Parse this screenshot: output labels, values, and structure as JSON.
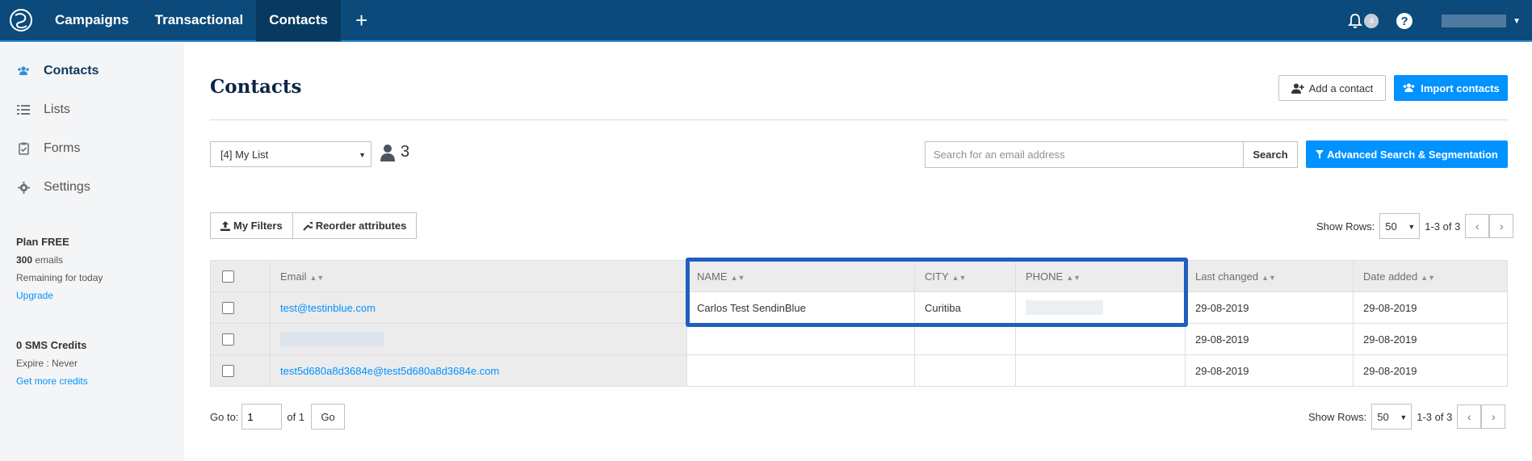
{
  "topnav": {
    "items": [
      "Campaigns",
      "Transactional",
      "Contacts"
    ],
    "active": "Contacts",
    "notification_count": "4"
  },
  "sidebar": {
    "items": [
      {
        "label": "Contacts",
        "icon": "users-icon"
      },
      {
        "label": "Lists",
        "icon": "list-icon"
      },
      {
        "label": "Forms",
        "icon": "clipboard-icon"
      },
      {
        "label": "Settings",
        "icon": "gear-icon"
      }
    ],
    "plan": {
      "title": "Plan FREE",
      "emails_count": "300",
      "emails_label": "emails",
      "remaining": "Remaining for today",
      "upgrade": "Upgrade"
    },
    "sms": {
      "title": "0 SMS Credits",
      "expire": "Expire : Never",
      "get_more": "Get more credits"
    }
  },
  "main": {
    "title": "Contacts",
    "add_contact": "Add a contact",
    "import_contacts": "Import contacts",
    "list_select": "[4] My List",
    "contact_count": "3",
    "search_placeholder": "Search for an email address",
    "search_button": "Search",
    "advanced_search": "Advanced Search & Segmentation",
    "my_filters": "My Filters",
    "reorder": "Reorder attributes",
    "show_rows_label": "Show Rows:",
    "rows_value": "50",
    "range": "1-3 of 3",
    "goto_label": "Go to:",
    "goto_value": "1",
    "of_pages": "of 1",
    "go_button": "Go"
  },
  "table": {
    "columns": [
      "Email",
      "NAME",
      "CITY",
      "PHONE",
      "Last changed",
      "Date added"
    ],
    "rows": [
      {
        "email": "test@testinblue.com",
        "name": "Carlos Test SendinBlue",
        "city": "Curitiba",
        "phone": "",
        "last_changed": "29-08-2019",
        "date_added": "29-08-2019"
      },
      {
        "email": "",
        "name": "",
        "city": "",
        "phone": "",
        "last_changed": "29-08-2019",
        "date_added": "29-08-2019"
      },
      {
        "email": "test5d680a8d3684e@test5d680a8d3684e.com",
        "name": "",
        "city": "",
        "phone": "",
        "last_changed": "29-08-2019",
        "date_added": "29-08-2019"
      }
    ]
  },
  "colors": {
    "nav_bg": "#0b4a7a",
    "accent": "#0092ff",
    "highlight_border": "#1f5fbf"
  }
}
